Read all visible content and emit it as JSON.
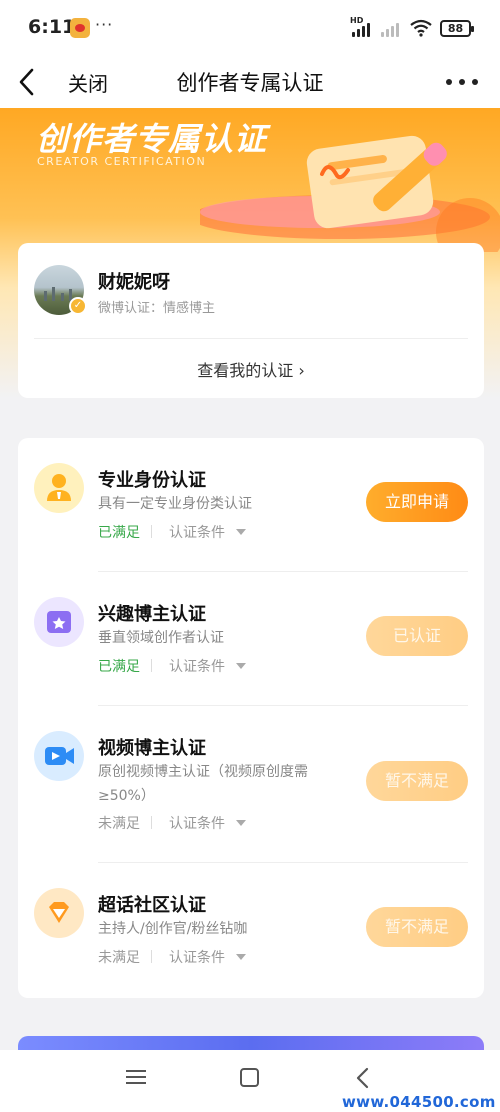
{
  "status_bar": {
    "time": "6:11",
    "dots": "···",
    "hd": "HD",
    "battery": "88"
  },
  "nav": {
    "close_label": "关闭",
    "title": "创作者专属认证"
  },
  "banner": {
    "title": "创作者专属认证",
    "subtitle": "CREATOR CERTIFICATION"
  },
  "profile": {
    "name": "财妮妮呀",
    "certification": "微博认证：情感博主",
    "view_link": "查看我的认证 ›"
  },
  "certifications": [
    {
      "title": "专业身份认证",
      "desc": "具有一定专业身份类认证",
      "status": "已满足",
      "condition": "认证条件",
      "button": "立即申请",
      "icon": "person-icon"
    },
    {
      "title": "兴趣博主认证",
      "desc": "垂直领域创作者认证",
      "status": "已满足",
      "condition": "认证条件",
      "button": "已认证",
      "icon": "star-folder-icon"
    },
    {
      "title": "视频博主认证",
      "desc": "原创视频博主认证（视频原创度需≥50%）",
      "status": "未满足",
      "condition": "认证条件",
      "button": "暂不满足",
      "icon": "video-camera-icon"
    },
    {
      "title": "超话社区认证",
      "desc": "主持人/创作官/粉丝钻咖",
      "status": "未满足",
      "condition": "认证条件",
      "button": "暂不满足",
      "icon": "diamond-icon"
    }
  ],
  "watermark": "www.044500.com",
  "colors": {
    "accent": "#ff8b15",
    "met": "#38a84a",
    "banner": "#ffa823"
  }
}
